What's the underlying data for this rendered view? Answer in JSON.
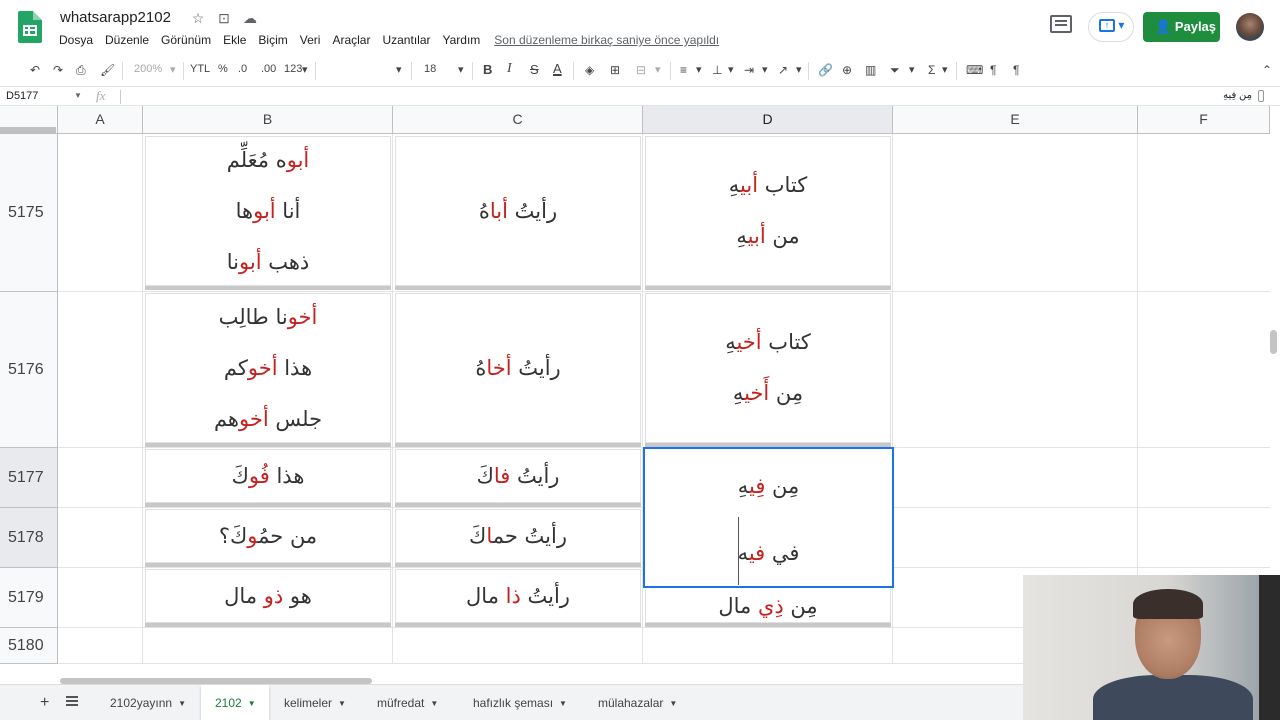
{
  "header": {
    "doc_title": "whatsarapp2102",
    "menu": [
      "Dosya",
      "Düzenle",
      "Görünüm",
      "Ekle",
      "Biçim",
      "Veri",
      "Araçlar",
      "Uzantılar",
      "Yardım"
    ],
    "last_edit": "Son düzenleme birkaç saniye önce yapıldı",
    "share_label": "Paylaş",
    "icons": [
      "star-icon",
      "folder-move-icon",
      "cloud-icon",
      "comment-icon",
      "present-icon",
      "user-icon"
    ]
  },
  "toolbar": {
    "zoom": "200%",
    "currency": "YTL",
    "percent": "%",
    "dec_decrease": ".0",
    "dec_increase": ".00",
    "format_more": "123",
    "font_size": "18",
    "bold": "B",
    "italic": "I",
    "strike": "S",
    "text_color": "A"
  },
  "formula_bar": {
    "cell_ref": "D5177",
    "fx": "fx",
    "value": "مِن فِيهِ"
  },
  "columns": [
    "A",
    "B",
    "C",
    "D",
    "E",
    "F"
  ],
  "rows": [
    "5175",
    "5176",
    "5177",
    "5178",
    "5179",
    "5180"
  ],
  "cells": {
    "b5175": [
      [
        "",
        "أبو",
        "ه مُعَلِّم"
      ],
      [
        "أنا ",
        "أبو",
        "ها"
      ],
      [
        "ذهب ",
        "أبو",
        "نا"
      ]
    ],
    "c5175": [
      [
        "رأيتُ ",
        "أبا",
        "هُ"
      ]
    ],
    "d5175": [
      [
        "كتاب ",
        "أبي",
        "هِ"
      ],
      [
        "من ",
        "أبي",
        "هِ"
      ]
    ],
    "b5176": [
      [
        "",
        "أخو",
        "نا طالِب"
      ],
      [
        "هذا ",
        "أخو",
        "كم"
      ],
      [
        "جلس ",
        "أخو",
        "هم"
      ]
    ],
    "c5176": [
      [
        "رأيتُ ",
        "أخا",
        "هُ"
      ]
    ],
    "d5176": [
      [
        "كتاب ",
        "أخي",
        "هِ"
      ],
      [
        "مِن ",
        "أَخي",
        "هِ"
      ]
    ],
    "b5177": [
      [
        "هذا ",
        "فُو",
        "كَ"
      ]
    ],
    "c5177": [
      [
        "رأيتُ ",
        "فا",
        "كَ"
      ]
    ],
    "d5177": [
      [
        "مِن ",
        "فِي",
        "هِ"
      ],
      [
        "في ",
        "في",
        "ه"
      ]
    ],
    "b5178": [
      [
        "من حمُ",
        "و",
        "كَ؟"
      ]
    ],
    "c5178": [
      [
        "رأيتُ حم",
        "ا",
        "كَ"
      ]
    ],
    "b5179": [
      [
        "هو ",
        "ذو",
        " مال"
      ]
    ],
    "c5179": [
      [
        "رأيتُ ",
        "ذا",
        " مال"
      ]
    ],
    "d5179": [
      [
        "مِن ",
        "ذِي",
        " مال"
      ]
    ]
  },
  "sheet_tabs": [
    "2102yayınn",
    "2102",
    "kelimeler",
    "müfredat",
    "hafızlık şeması",
    "mülahazalar"
  ],
  "active_tab": "2102",
  "colors": {
    "accent": "#1a73e8",
    "share": "#1e8e3e",
    "highlight": "#c5221f",
    "active_tab": "#188038"
  }
}
